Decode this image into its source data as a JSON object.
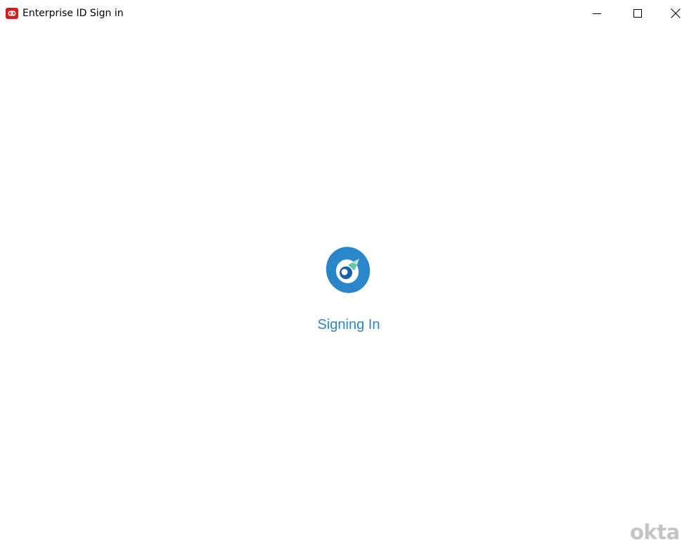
{
  "window": {
    "title": "Enterprise ID Sign in",
    "icon": "enterprise-id-app-icon",
    "controls": {
      "minimize": "minimize-icon",
      "maximize": "maximize-icon",
      "close": "close-icon"
    }
  },
  "main": {
    "status_text": "Signing In",
    "spinner_icon": "loading-logo-icon",
    "status_color": "#2d87c8"
  },
  "footer": {
    "brand": "okta",
    "brand_color": "#c4c4c4"
  },
  "colors": {
    "app_icon_red": "#d01f1f",
    "logo_blue": "#2a86c9",
    "logo_dark_blue": "#1a5fa8",
    "logo_green": "#5ec7a5"
  }
}
